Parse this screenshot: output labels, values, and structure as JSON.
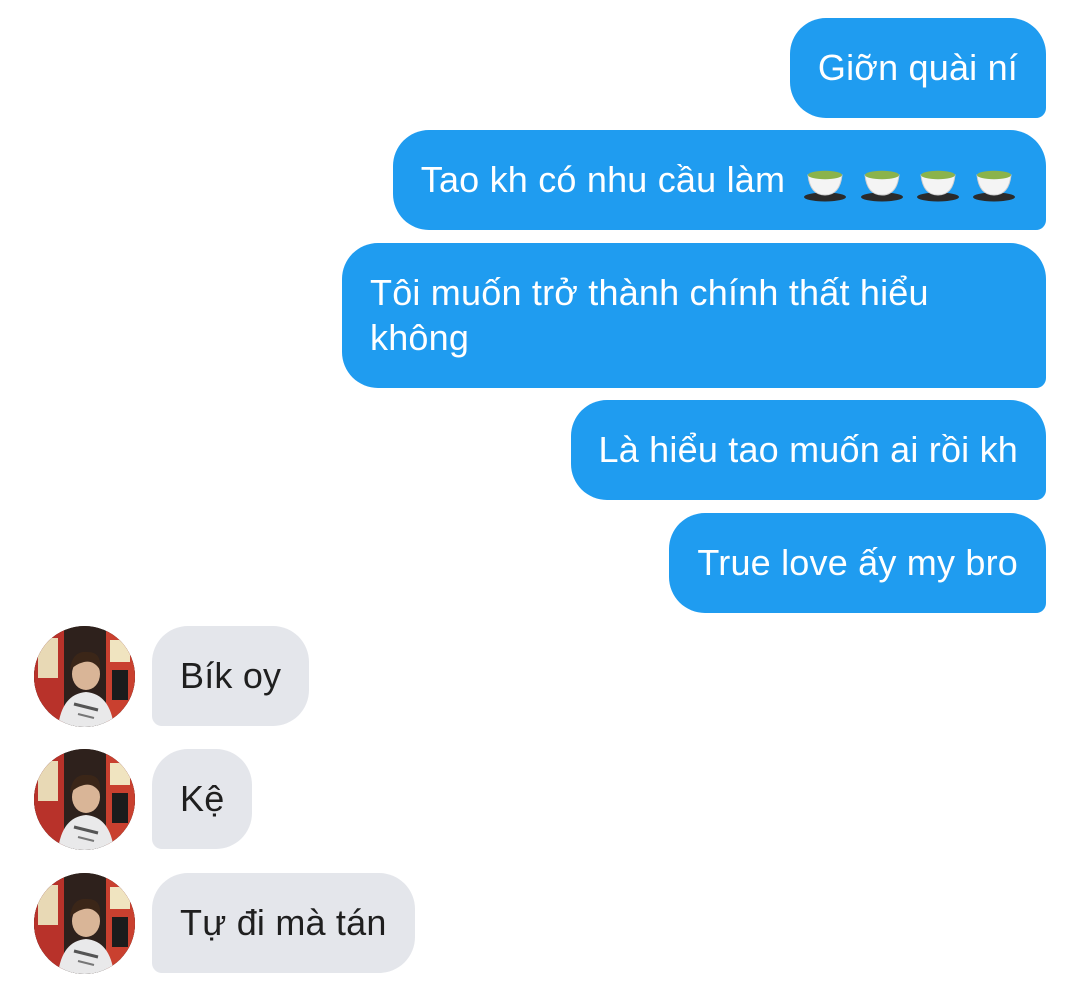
{
  "conversation": {
    "sent": [
      {
        "text": "Giỡn quài ní"
      },
      {
        "text": "Tao kh có nhu cầu làm",
        "emoji": [
          "teacup-icon",
          "teacup-icon",
          "teacup-icon",
          "teacup-icon"
        ]
      },
      {
        "line1": "Tôi muốn trở thành chính thất hiểu",
        "line2": "không"
      },
      {
        "text": "Là hiểu tao muốn ai rồi kh"
      },
      {
        "text": "True love ấy my bro"
      }
    ],
    "received": [
      {
        "text": "Bík oy"
      },
      {
        "text": "Kệ"
      },
      {
        "text": "Tự đi mà tán"
      }
    ]
  },
  "colors": {
    "sent_bubble": "#1f9cf0",
    "received_bubble": "#e4e6eb",
    "sent_text": "#ffffff",
    "received_text": "#1f1f1f"
  }
}
